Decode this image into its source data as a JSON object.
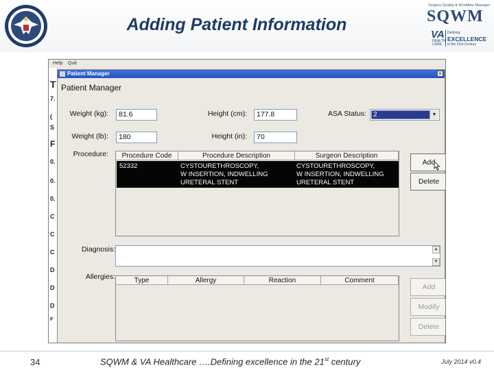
{
  "slide": {
    "title": "Adding Patient Information",
    "page_number": "34",
    "footer_text_before_sup": "SQWM & VA Healthcare ….Defining excellence in the 21",
    "footer_sup": "st",
    "footer_text_after_sup": " century",
    "footer_date": "July 2014  v0.4"
  },
  "logo": {
    "tagline": "Surgery Quality & Workflow Manager",
    "name": "SQWM",
    "va": "VA",
    "healthcare_line1": "HEALTH",
    "healthcare_line2": "CARE",
    "defining": "Defining",
    "excellence": "EXCELLENCE",
    "century": "in the 21st Century"
  },
  "background_window": {
    "menu_items": [
      "Help",
      "Quit"
    ],
    "strip_letters": [
      "T",
      "7.",
      "(",
      "S",
      "F",
      "0.",
      "0.",
      "0.",
      "C",
      "C",
      "C",
      "D",
      "D",
      "D",
      "F"
    ]
  },
  "dialog": {
    "window_title": "Patient Manager",
    "heading": "Patient Manager",
    "close_glyph": "×",
    "weight_kg_label": "Weight (kg):",
    "weight_kg_value": "81.6",
    "height_cm_label": "Height (cm):",
    "height_cm_value": "177.8",
    "asa_label": "ASA Status:",
    "asa_value": "2",
    "weight_lb_label": "Weight (lb):",
    "weight_lb_value": "180",
    "height_in_label": "Height (in):",
    "height_in_value": "70",
    "procedure_label": "Procedure:",
    "procedure_table": {
      "columns": [
        "Procedure Code",
        "Procedure Description",
        "Surgeon Description"
      ],
      "rows": [
        {
          "code": "52332",
          "description": [
            "CYSTOURETHROSCOPY,",
            "W INSERTION, INDWELLING",
            "URETERAL STENT"
          ],
          "surgeon_description": [
            "CYSTOURETHROSCOPY,",
            "W INSERTION, INDWELLING",
            "URETERAL STENT"
          ]
        }
      ]
    },
    "procedure_buttons": {
      "add": "Add",
      "delete": "Delete"
    },
    "diagnosis_label": "Diagnosis:",
    "diagnosis_value": "",
    "allergies_label": "Allergies:",
    "allergies_table": {
      "columns": [
        "Type",
        "Allergy",
        "Reaction",
        "Comment"
      ]
    },
    "allergy_buttons": {
      "add": "Add",
      "modify": "Modify",
      "delete": "Delete"
    }
  }
}
